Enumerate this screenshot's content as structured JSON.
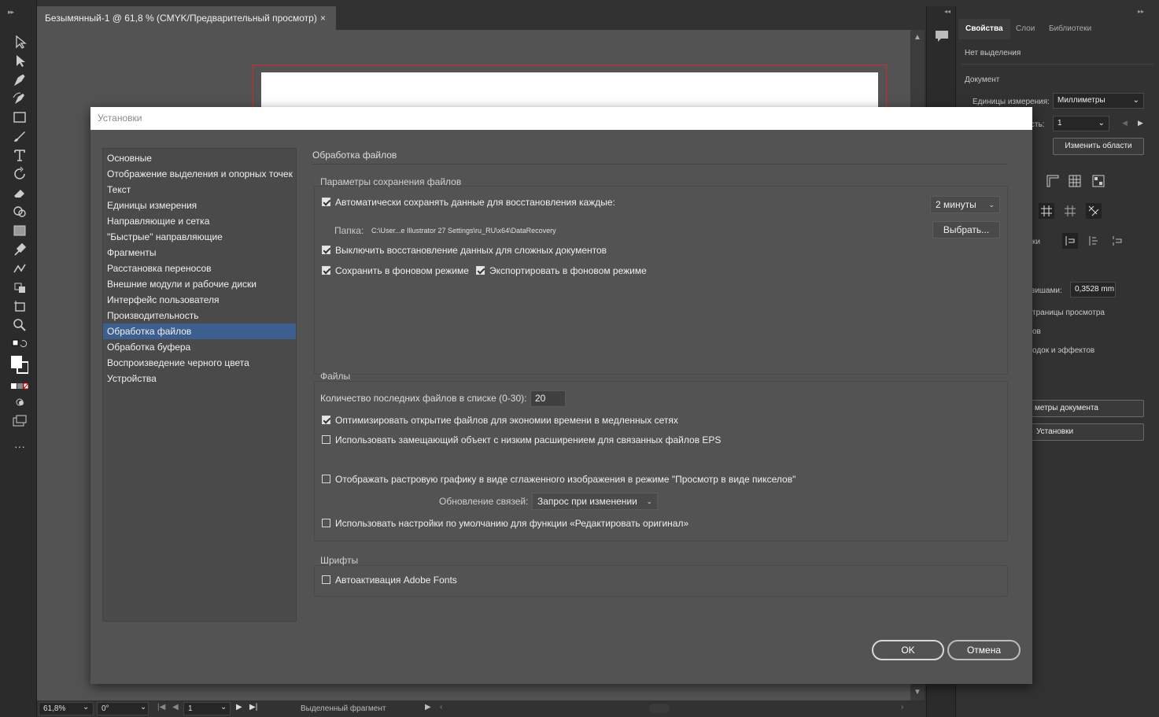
{
  "document": {
    "tab_title": "Безымянный-1 @ 61,8 % (CMYK/Предварительный просмотр)",
    "tab_close": "×"
  },
  "statusbar": {
    "zoom": "61,8%",
    "rotation": "0°",
    "artboard_number": "1",
    "status_text": "Выделенный фрагмент"
  },
  "right_panel": {
    "tabs": [
      "Свойства",
      "Слои",
      "Библиотеки"
    ],
    "no_selection": "Нет выделения",
    "document_header": "Документ",
    "units_label": "Единицы измерения:",
    "units_value": "Миллиметры",
    "artboard_label": "сть:",
    "artboard_value": "1",
    "edit_artboards_button": "Изменить области",
    "ruler_label": "ки",
    "keyboard_inc_label": "вишами:",
    "keyboard_inc_value": "0,3528 mm",
    "preview_bounds": "траницы просмотра",
    "partial_1": "ов",
    "partial_2": "одок и эффектов",
    "doc_setup_button": "метры документа",
    "preferences_button": "Установки"
  },
  "dialog": {
    "title": "Установки",
    "categories": [
      "Основные",
      "Отображение выделения и опорных точек",
      "Текст",
      "Единицы измерения",
      "Направляющие и сетка",
      "\"Быстрые\" направляющие",
      "Фрагменты",
      "Расстановка переносов",
      "Внешние модули и рабочие диски",
      "Интерфейс пользователя",
      "Производительность",
      "Обработка файлов",
      "Обработка буфера",
      "Воспроизведение черного цвета",
      "Устройства"
    ],
    "selected_index": 11,
    "page_title": "Обработка файлов",
    "save_section": {
      "title": "Параметры сохранения файлов",
      "autosave_label": "Автоматически сохранять данные для восстановления каждые:",
      "autosave_checked": true,
      "interval_value": "2 минуты",
      "folder_label": "Папка:",
      "folder_path": "C:\\User...e Illustrator 27 Settings\\ru_RU\\x64\\DataRecovery",
      "choose_button": "Выбрать...",
      "disable_recovery_label": "Выключить восстановление данных для сложных документов",
      "disable_recovery_checked": true,
      "bg_save_label": "Сохранить в фоновом режиме",
      "bg_save_checked": true,
      "bg_export_label": "Экспортировать в фоновом режиме",
      "bg_export_checked": true
    },
    "files_section": {
      "title": "Файлы",
      "recent_label": "Количество последних файлов в списке (0-30):",
      "recent_value": "20",
      "optimize_label": "Оптимизировать открытие файлов для экономии времени в медленных сетях",
      "optimize_checked": true,
      "eps_proxy_label": "Использовать замещающий объект с низким расширением для связанных файлов EPS",
      "eps_proxy_checked": false,
      "antialias_label": "Отображать растровую графику в виде сглаженного изображения в режиме \"Просмотр в виде пикселов\"",
      "antialias_checked": false,
      "update_links_label": "Обновление связей:",
      "update_links_value": "Запрос при изменении",
      "edit_original_label": "Использовать настройки по умолчанию для функции «Редактировать оригинал»",
      "edit_original_checked": false
    },
    "fonts_section": {
      "title": "Шрифты",
      "autoactivate_label": "Автоактивация Adobe Fonts",
      "autoactivate_checked": false
    },
    "ok_button": "OK",
    "cancel_button": "Отмена"
  },
  "colors": {
    "selection": "#3d5f90",
    "artboard_border": "#d42a2a"
  }
}
